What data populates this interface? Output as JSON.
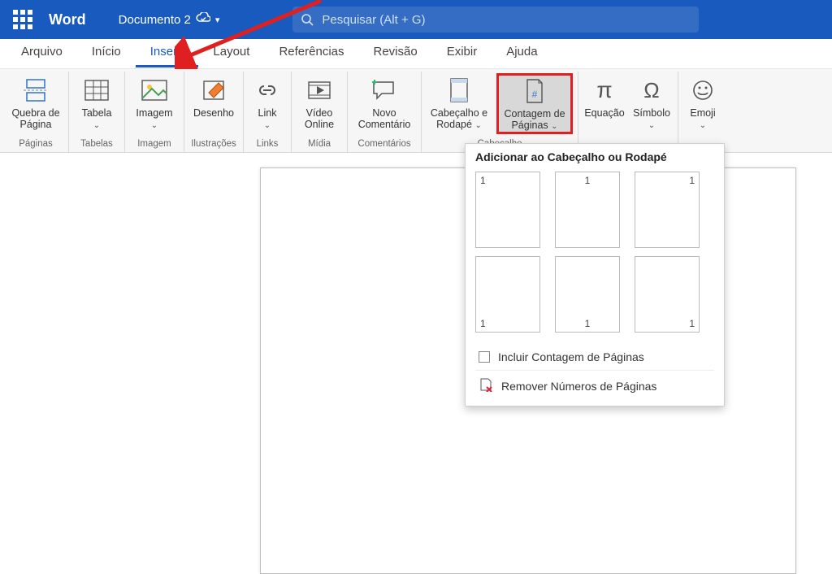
{
  "header": {
    "app_name": "Word",
    "doc_name": "Documento 2",
    "search_placeholder": "Pesquisar (Alt + G)"
  },
  "tabs": {
    "items": [
      "Arquivo",
      "Início",
      "Inserir",
      "Layout",
      "Referências",
      "Revisão",
      "Exibir",
      "Ajuda"
    ],
    "active_index": 2
  },
  "ribbon": {
    "groups": [
      {
        "label": "Páginas",
        "buttons": [
          {
            "label": "Quebra de Página",
            "dropdown": false
          }
        ]
      },
      {
        "label": "Tabelas",
        "buttons": [
          {
            "label": "Tabela",
            "dropdown": true
          }
        ]
      },
      {
        "label": "Imagem",
        "buttons": [
          {
            "label": "Imagem",
            "dropdown": true
          }
        ]
      },
      {
        "label": "Ilustrações",
        "buttons": [
          {
            "label": "Desenho",
            "dropdown": false
          }
        ]
      },
      {
        "label": "Links",
        "buttons": [
          {
            "label": "Link",
            "dropdown": true
          }
        ]
      },
      {
        "label": "Mídia",
        "buttons": [
          {
            "label": "Vídeo Online",
            "dropdown": false
          }
        ]
      },
      {
        "label": "Comentários",
        "buttons": [
          {
            "label": "Novo Comentário",
            "dropdown": false
          }
        ]
      },
      {
        "label": "Cabeçalho",
        "buttons": [
          {
            "label": "Cabeçalho e Rodapé",
            "dropdown": true
          },
          {
            "label": "Contagem de Páginas",
            "dropdown": true,
            "highlighted": true
          }
        ]
      },
      {
        "label": "",
        "buttons": [
          {
            "label": "Equação",
            "dropdown": false
          },
          {
            "label": "Símbolo",
            "dropdown": true
          }
        ]
      },
      {
        "label": "",
        "buttons": [
          {
            "label": "Emoji",
            "dropdown": true
          }
        ]
      }
    ]
  },
  "dropdown": {
    "title": "Adicionar ao Cabeçalho ou Rodapé",
    "sample_number": "1",
    "include_count": "Incluir Contagem de Páginas",
    "remove": "Remover Números de Páginas"
  }
}
